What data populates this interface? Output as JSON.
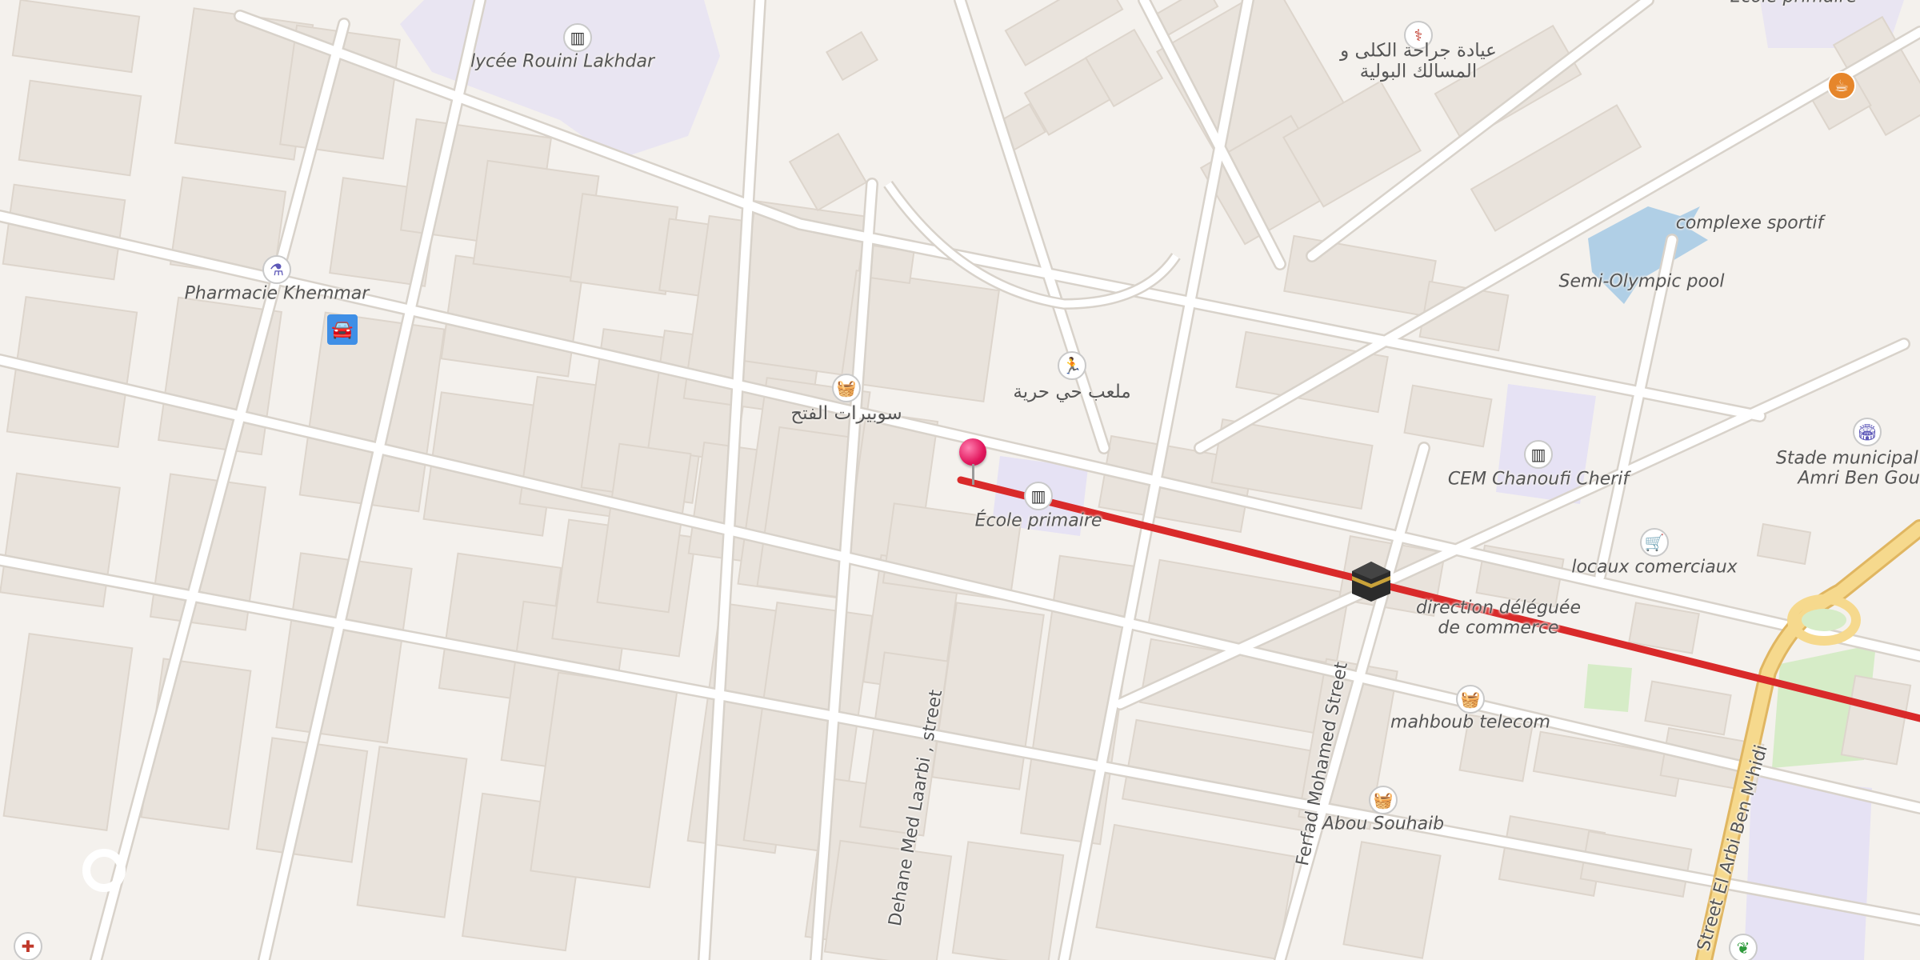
{
  "map": {
    "route_color": "#d92a2a",
    "pin_color": "#e2175d"
  },
  "labels": {
    "lycee": "lycée Rouini Lakhdar",
    "clinic_ar_1": "عيادة جراحة الكلى و",
    "clinic_ar_2": "المسالك البولية",
    "ecole_top": "École primaire",
    "complexe": "complexe sportif",
    "pool": "Semi-Olympic pool",
    "pharmacie": "Pharmacie Khemmar",
    "stade_ar": "ملعب حي حرية",
    "superette_ar": "سوبيرات الفتح",
    "ecole_primaire": "École primaire",
    "cem": "CEM Chanoufi Cherif",
    "stade_1": "Stade municipal C",
    "stade_2": "Amri Ben Gouid",
    "locaux": "locaux comerciaux",
    "direction_1": "direction déléguée",
    "direction_2": "de commerce",
    "mahboub": "mahboub telecom",
    "abou": "Abou Souhaib"
  },
  "streets": {
    "dehane": "Dehane Med Laarbi , street",
    "ferfad": "Ferfad Mohamed Street",
    "elarbi": "Street El Arbi Ben M'hidi"
  },
  "icons": {
    "school": "school-icon",
    "clinic": "stethoscope-icon",
    "cafe": "cafe-icon",
    "pharmacy": "pharmacy-icon",
    "parking": "car-icon",
    "sport": "running-icon",
    "shop": "basket-icon",
    "cart": "cart-icon",
    "stadium": "stadium-icon",
    "hospital": "red-cross-icon",
    "garden": "plant-icon",
    "qibla": "kaaba-icon",
    "pin": "location-pin-icon"
  }
}
